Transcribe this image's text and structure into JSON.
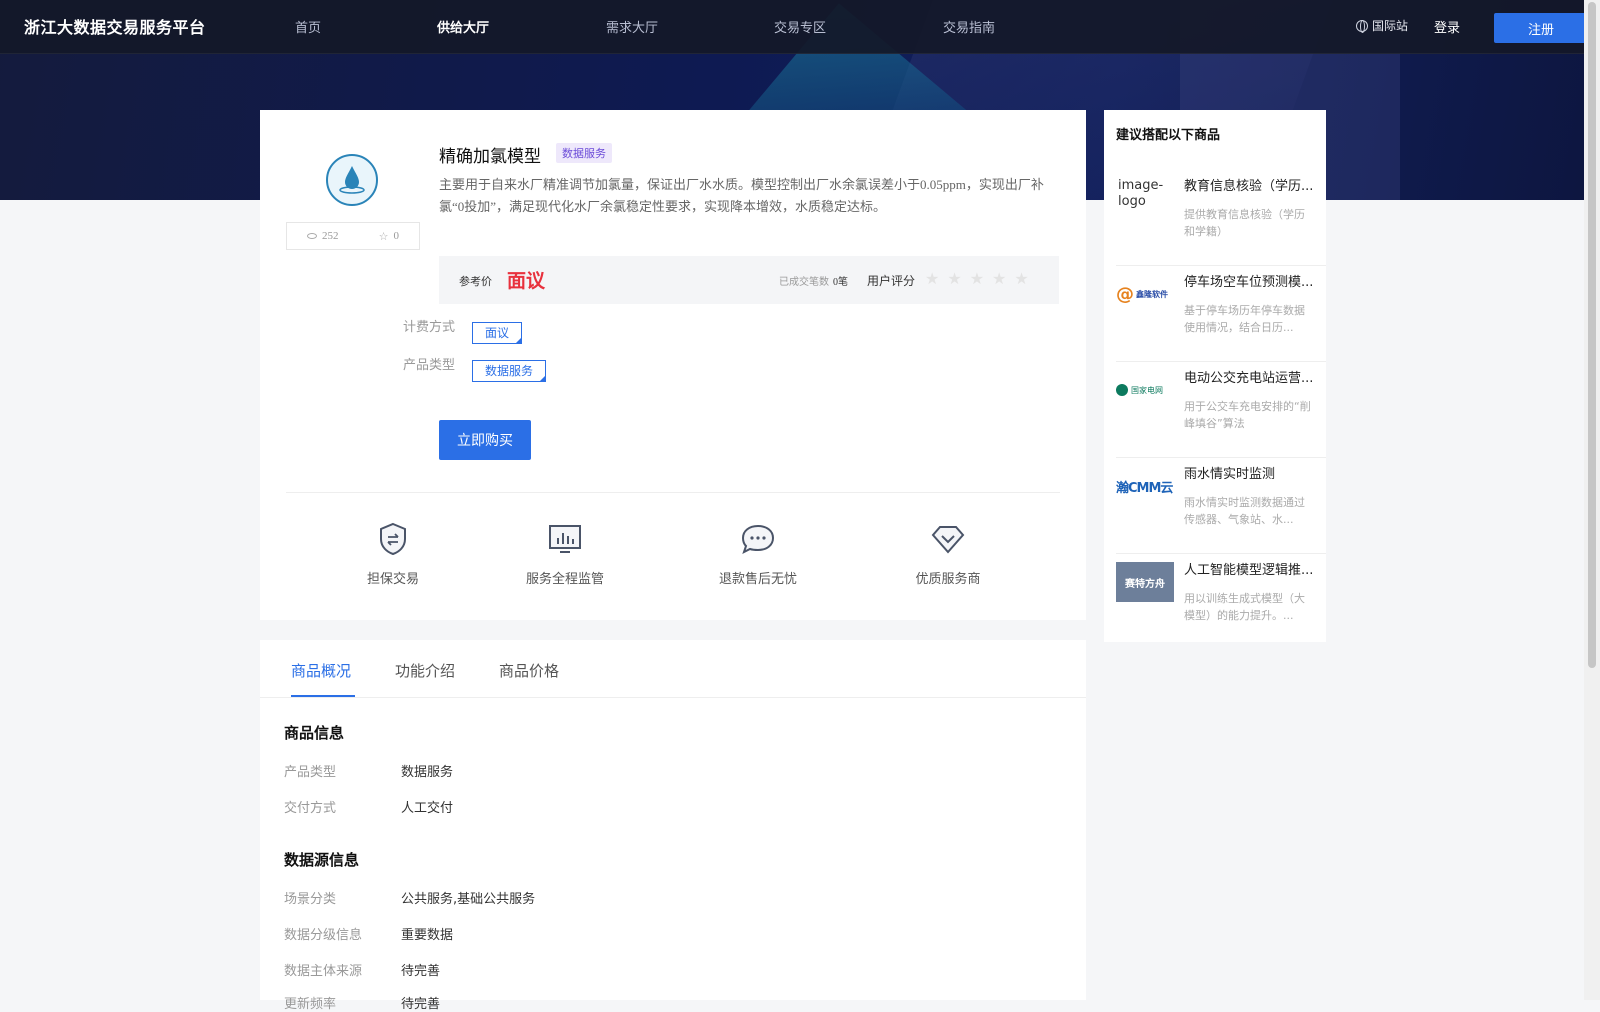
{
  "nav": {
    "logo": "浙江大数据交易服务平台",
    "items": [
      "首页",
      "供给大厅",
      "需求大厅",
      "交易专区",
      "交易指南"
    ],
    "intl": "国际站",
    "login": "登录",
    "register": "注册"
  },
  "product": {
    "title": "精确加氯模型",
    "tag": "数据服务",
    "views": "252",
    "favorites": "0",
    "description": "主要用于自来水厂精准调节加氯量，保证出厂水水质。模型控制出厂水余氯误差小于0.05ppm，实现出厂补氯“0投加”，满足现代化水厂余氯稳定性要求，实现降本增效，水质稳定达标。",
    "price_label": "参考价",
    "price": "面议",
    "deal_label": "已成交笔数",
    "deal_count": "0笔",
    "rating_label": "用户评分",
    "rating": 0,
    "billing_label": "计费方式",
    "billing_value": "面议",
    "type_label": "产品类型",
    "type_value": "数据服务",
    "buy_label": "立即购买"
  },
  "features": [
    {
      "label": "担保交易",
      "icon": "shield-icon"
    },
    {
      "label": "服务全程监管",
      "icon": "monitor-icon"
    },
    {
      "label": "退款售后无忧",
      "icon": "chat-icon"
    },
    {
      "label": "优质服务商",
      "icon": "diamond-icon"
    }
  ],
  "side": {
    "title": "建议搭配以下商品",
    "items": [
      {
        "title": "教育信息核验（学历...",
        "desc": "提供教育信息核验（学历和学籍）",
        "thumb_alt": "image-logo"
      },
      {
        "title": "停车场空车位预测模...",
        "desc": "基于停车场历年停车数据使用情况，结合日历..."
      },
      {
        "title": "电动公交充电站运营...",
        "desc": "用于公交车充电安排的“削峰填谷”算法"
      },
      {
        "title": "雨水情实时监测",
        "desc": "雨水情实时监测数据通过传感器、气象站、水..."
      },
      {
        "title": "人工智能模型逻辑推...",
        "desc": "用以训练生成式模型（大模型）的能力提升。..."
      }
    ],
    "thumb_texts": {
      "parking": "鑫隆软件",
      "bus": "国家电网",
      "rain": "瀚CMM云",
      "ai": "赛特方舟"
    }
  },
  "tabs": [
    "商品概况",
    "功能介绍",
    "商品价格"
  ],
  "info": {
    "product_section": "商品信息",
    "rows1": [
      {
        "k": "产品类型",
        "v": "数据服务"
      },
      {
        "k": "交付方式",
        "v": "人工交付"
      }
    ],
    "source_section": "数据源信息",
    "rows2": [
      {
        "k": "场景分类",
        "v": "公共服务,基础公共服务"
      },
      {
        "k": "数据分级信息",
        "v": "重要数据"
      },
      {
        "k": "数据主体来源",
        "v": "待完善"
      },
      {
        "k": "更新频率",
        "v": "待完善"
      }
    ]
  },
  "colors": {
    "accent": "#2b6fe6",
    "price": "#e8313d",
    "tag_bg": "#eee8fb"
  }
}
